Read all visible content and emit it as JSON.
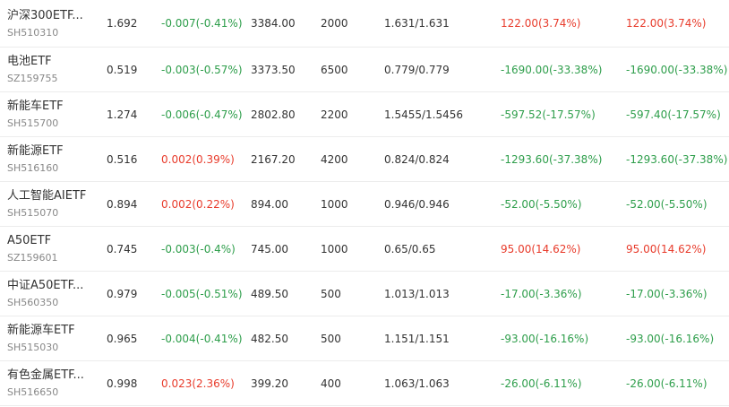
{
  "colors": {
    "up": "#e83b2b",
    "down": "#2e9e4b"
  },
  "rows": [
    {
      "name": "沪深300ETF...",
      "code": "SH510310",
      "price": "1.692",
      "change": "-0.007(-0.41%)",
      "change_dir": "down",
      "value": "3384.00",
      "qty": "2000",
      "cost": "1.631/1.631",
      "pnl1": "122.00(3.74%)",
      "pnl1_dir": "up",
      "pnl2": "122.00(3.74%)",
      "pnl2_dir": "up"
    },
    {
      "name": "电池ETF",
      "code": "SZ159755",
      "price": "0.519",
      "change": "-0.003(-0.57%)",
      "change_dir": "down",
      "value": "3373.50",
      "qty": "6500",
      "cost": "0.779/0.779",
      "pnl1": "-1690.00(-33.38%)",
      "pnl1_dir": "down",
      "pnl2": "-1690.00(-33.38%)",
      "pnl2_dir": "down"
    },
    {
      "name": "新能车ETF",
      "code": "SH515700",
      "price": "1.274",
      "change": "-0.006(-0.47%)",
      "change_dir": "down",
      "value": "2802.80",
      "qty": "2200",
      "cost": "1.5455/1.5456",
      "pnl1": "-597.52(-17.57%)",
      "pnl1_dir": "down",
      "pnl2": "-597.40(-17.57%)",
      "pnl2_dir": "down"
    },
    {
      "name": "新能源ETF",
      "code": "SH516160",
      "price": "0.516",
      "change": "0.002(0.39%)",
      "change_dir": "up",
      "value": "2167.20",
      "qty": "4200",
      "cost": "0.824/0.824",
      "pnl1": "-1293.60(-37.38%)",
      "pnl1_dir": "down",
      "pnl2": "-1293.60(-37.38%)",
      "pnl2_dir": "down"
    },
    {
      "name": "人工智能AIETF",
      "code": "SH515070",
      "price": "0.894",
      "change": "0.002(0.22%)",
      "change_dir": "up",
      "value": "894.00",
      "qty": "1000",
      "cost": "0.946/0.946",
      "pnl1": "-52.00(-5.50%)",
      "pnl1_dir": "down",
      "pnl2": "-52.00(-5.50%)",
      "pnl2_dir": "down"
    },
    {
      "name": "A50ETF",
      "code": "SZ159601",
      "price": "0.745",
      "change": "-0.003(-0.4%)",
      "change_dir": "down",
      "value": "745.00",
      "qty": "1000",
      "cost": "0.65/0.65",
      "pnl1": "95.00(14.62%)",
      "pnl1_dir": "up",
      "pnl2": "95.00(14.62%)",
      "pnl2_dir": "up"
    },
    {
      "name": "中证A50ETF...",
      "code": "SH560350",
      "price": "0.979",
      "change": "-0.005(-0.51%)",
      "change_dir": "down",
      "value": "489.50",
      "qty": "500",
      "cost": "1.013/1.013",
      "pnl1": "-17.00(-3.36%)",
      "pnl1_dir": "down",
      "pnl2": "-17.00(-3.36%)",
      "pnl2_dir": "down"
    },
    {
      "name": "新能源车ETF",
      "code": "SH515030",
      "price": "0.965",
      "change": "-0.004(-0.41%)",
      "change_dir": "down",
      "value": "482.50",
      "qty": "500",
      "cost": "1.151/1.151",
      "pnl1": "-93.00(-16.16%)",
      "pnl1_dir": "down",
      "pnl2": "-93.00(-16.16%)",
      "pnl2_dir": "down"
    },
    {
      "name": "有色金属ETF...",
      "code": "SH516650",
      "price": "0.998",
      "change": "0.023(2.36%)",
      "change_dir": "up",
      "value": "399.20",
      "qty": "400",
      "cost": "1.063/1.063",
      "pnl1": "-26.00(-6.11%)",
      "pnl1_dir": "down",
      "pnl2": "-26.00(-6.11%)",
      "pnl2_dir": "down"
    }
  ]
}
